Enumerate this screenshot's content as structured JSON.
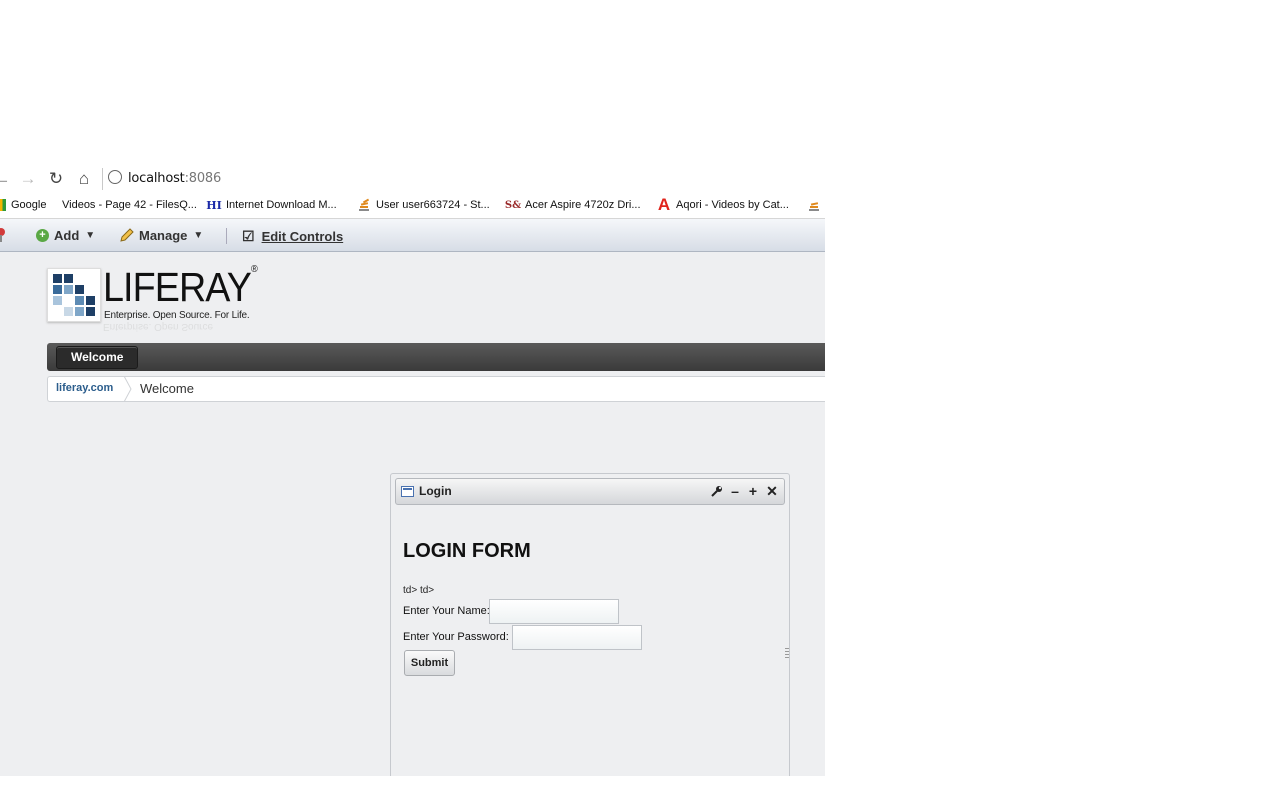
{
  "browser": {
    "url_host": "localhost",
    "url_port": ":8086",
    "bookmarks": [
      {
        "label": "Google",
        "icon": "google-icon"
      },
      {
        "label": "Videos - Page 42 - FilesQ...",
        "icon": "page-icon"
      },
      {
        "label": "Internet Download M...",
        "icon": "idm-icon",
        "glyph": "HI"
      },
      {
        "label": "User user663724 - St...",
        "icon": "stackoverflow-icon"
      },
      {
        "label": "Acer Aspire 4720z Dri...",
        "icon": "site-icon",
        "glyph": "S&"
      },
      {
        "label": "Aqori - Videos by Cat...",
        "icon": "aqori-icon",
        "glyph": "A"
      }
    ]
  },
  "dockbar": {
    "add_label": "Add",
    "manage_label": "Manage",
    "edit_controls_label": "Edit Controls"
  },
  "logo": {
    "wordmark": "LIFERAY",
    "registered": "®",
    "tagline": "Enterprise. Open Source. For Life."
  },
  "nav": {
    "tabs": [
      {
        "label": "Welcome"
      }
    ]
  },
  "breadcrumb": {
    "items": [
      "liferay.com",
      "Welcome"
    ]
  },
  "portlet": {
    "title": "Login",
    "heading": "LOGIN FORM",
    "raw_text": "td> td>",
    "name_label": "Enter Your Name:",
    "password_label": "Enter Your Password:",
    "name_value": "",
    "password_value": "",
    "submit_label": "Submit"
  },
  "colors": {
    "nav_bar": "#3a3a3a",
    "breadcrumb_link": "#2b5d8c",
    "page_bg": "#eeeff1",
    "add_icon": "#5aa845"
  }
}
